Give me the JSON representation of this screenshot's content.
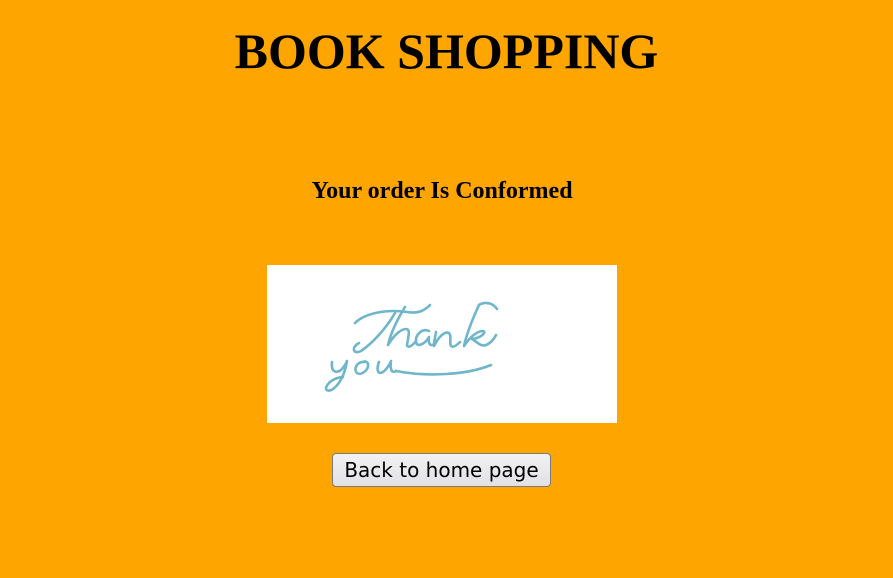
{
  "page": {
    "title": "BOOK SHOPPING",
    "background_color": "#FFA500"
  },
  "main": {
    "message": "Your order Is Conformed",
    "image": {
      "alt": "Thank you",
      "script_color": "#6fb6cc"
    },
    "home_button_label": "Back to home page"
  }
}
